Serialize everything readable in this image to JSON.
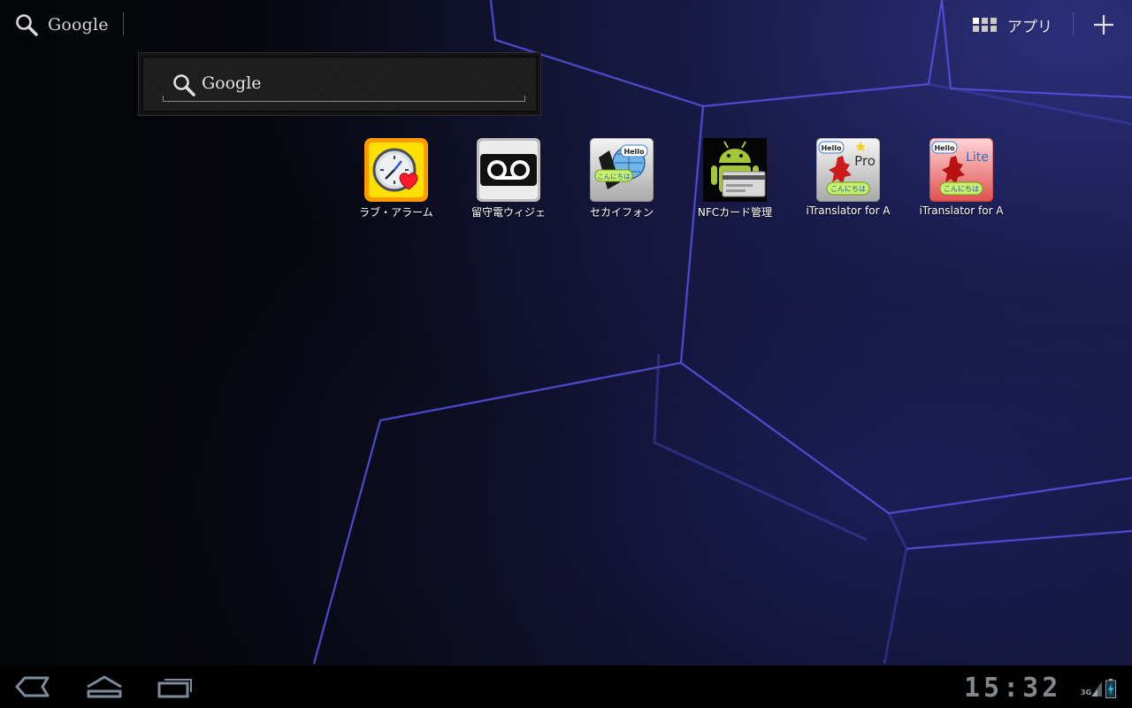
{
  "top_bar": {
    "search_label": "Google",
    "apps_label": "アプリ"
  },
  "widget": {
    "search_label": "Google"
  },
  "apps": [
    {
      "name": "ラブ・アラーム",
      "icon": "love-alarm-icon"
    },
    {
      "name": "留守電ウィジェ",
      "icon": "voicemail-widget-icon"
    },
    {
      "name": "セカイフォン",
      "icon": "sekai-phone-icon"
    },
    {
      "name": "NFCカード管理",
      "icon": "nfc-card-manager-icon"
    },
    {
      "name": "iTranslator for A",
      "icon": "itranslator-pro-icon"
    },
    {
      "name": "iTranslator for A",
      "icon": "itranslator-lite-icon"
    }
  ],
  "app_badges": {
    "hello": "Hello",
    "konnichiwa": "こんにちは",
    "pro": "Pro",
    "lite": "Lite"
  },
  "status_bar": {
    "time": "15:32",
    "network": "3G"
  },
  "colors": {
    "accent_blue": "#33b5e5",
    "wallpaper_glow": "#2a2f78"
  }
}
